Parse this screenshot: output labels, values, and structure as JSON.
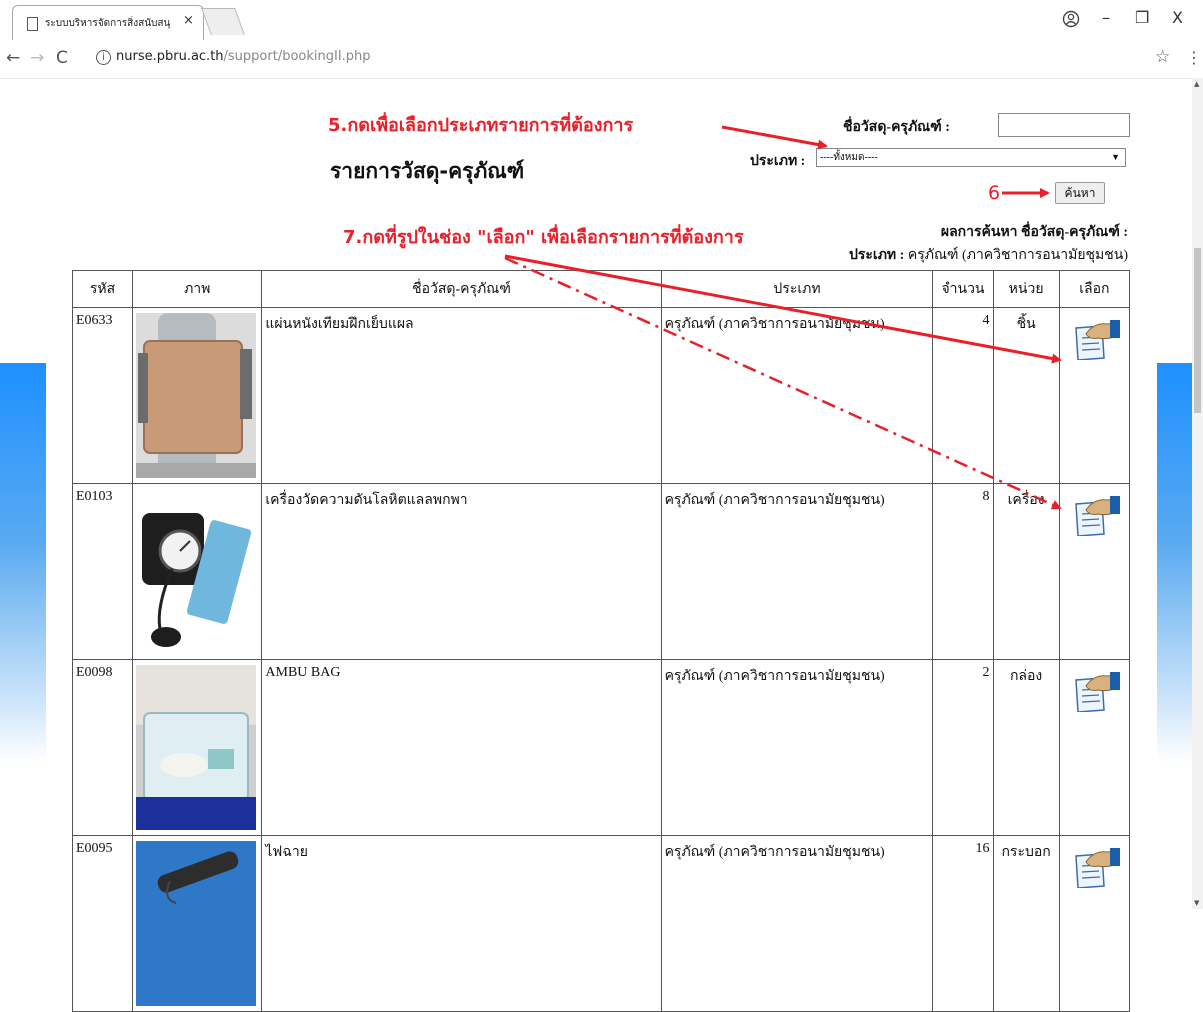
{
  "browser": {
    "tab_title": "ระบบบริหารจัดการสิ่งสนับสนุ",
    "tab_close": "×",
    "url_host": "nurse.pbru.ac.th",
    "url_path": "/support/bookingII.php",
    "controls": {
      "minimize": "–",
      "restore": "❐",
      "close": "X"
    }
  },
  "annotations": {
    "step5": "5.กดเพื่อเลือกประเภทรายการที่ต้องการ",
    "step6": "6",
    "step7": "7.กดที่รูปในช่อง \"เลือก\" เพื่อเลือกรายการที่ต้องการ"
  },
  "page": {
    "title": "รายการวัสดุ-ครุภัณฑ์"
  },
  "search": {
    "name_label": "ชื่อวัสดุ-ครุภัณฑ์ :",
    "name_value": "",
    "type_label": "ประเภท :",
    "type_selected": "----ทั้งหมด----",
    "button_label": "ค้นหา"
  },
  "result": {
    "line1_label": "ผลการค้นหา ชื่อวัสดุ-ครุภัณฑ์ :",
    "line2_label": "ประเภท :",
    "line2_value": "ครุภัณฑ์ (ภาควิชาการอนามัยชุมชน)"
  },
  "table": {
    "headers": [
      "รหัส",
      "ภาพ",
      "ชื่อวัสดุ-ครุภัณฑ์",
      "ประเภท",
      "จำนวน",
      "หน่วย",
      "เลือก"
    ],
    "rows": [
      {
        "code": "E0633",
        "name": "แผ่นหนังเทียมฝึกเย็บแผล",
        "category": "ครุภัณฑ์ (ภาควิชาการอนามัยชุมชน)",
        "qty": "4",
        "unit": "ชิ้น"
      },
      {
        "code": "E0103",
        "name": "เครื่องวัดความดันโลหิตแลลพกพา",
        "category": "ครุภัณฑ์ (ภาควิชาการอนามัยชุมชน)",
        "qty": "8",
        "unit": "เครื่อง"
      },
      {
        "code": "E0098",
        "name": "AMBU BAG",
        "category": "ครุภัณฑ์ (ภาควิชาการอนามัยชุมชน)",
        "qty": "2",
        "unit": "กล่อง"
      },
      {
        "code": "E0095",
        "name": "ไฟฉาย",
        "category": "ครุภัณฑ์ (ภาควิชาการอนามัยชุมชน)",
        "qty": "16",
        "unit": "กระบอก"
      }
    ]
  },
  "colors": {
    "annotation": "#e8202a",
    "sidebar": "#1e90ff"
  }
}
